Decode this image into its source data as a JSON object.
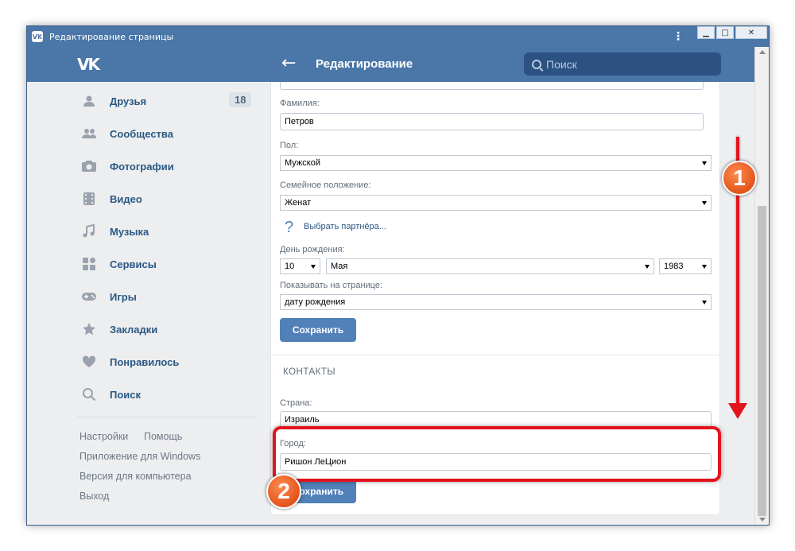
{
  "window": {
    "title": "Редактирование страницы",
    "app_badge": "VK",
    "close_glyph": "✕"
  },
  "header": {
    "logo": "VK",
    "title": "Редактирование",
    "search_placeholder": "Поиск"
  },
  "sidebar": {
    "items": [
      {
        "label": "Друзья",
        "icon": "person-icon",
        "badge": "18"
      },
      {
        "label": "Сообщества",
        "icon": "people-icon"
      },
      {
        "label": "Фотографии",
        "icon": "camera-icon"
      },
      {
        "label": "Видео",
        "icon": "film-icon"
      },
      {
        "label": "Музыка",
        "icon": "music-note-icon"
      },
      {
        "label": "Сервисы",
        "icon": "grid-icon"
      },
      {
        "label": "Игры",
        "icon": "gamepad-icon"
      },
      {
        "label": "Закладки",
        "icon": "star-icon"
      },
      {
        "label": "Понравилось",
        "icon": "heart-icon"
      },
      {
        "label": "Поиск",
        "icon": "search-icon"
      }
    ],
    "footer": {
      "settings": "Настройки",
      "help": "Помощь",
      "windows_app": "Приложение для Windows",
      "desktop_version": "Версия для компьютера",
      "logout": "Выход"
    }
  },
  "form": {
    "surname_label": "Фамилия:",
    "surname_value": "Петров",
    "gender_label": "Пол:",
    "gender_value": "Мужской",
    "marital_label": "Семейное положение:",
    "marital_value": "Женат",
    "partner_icon": "?",
    "partner_link": "Выбрать партнёра...",
    "birthday_label": "День рождения:",
    "birth_day": "10",
    "birth_month": "Мая",
    "birth_year": "1983",
    "show_label": "Показывать на странице:",
    "show_value": "дату рождения",
    "save_label": "Сохранить"
  },
  "contacts": {
    "section_title": "КОНТАКТЫ",
    "country_label": "Страна:",
    "country_value": "Израиль",
    "city_label": "Город:",
    "city_value": "Ришон ЛеЦион",
    "save_label": "Сохранить"
  },
  "annotations": {
    "marker1": "1",
    "marker2": "2",
    "color": "#e3141e"
  },
  "colors": {
    "brand": "#4a76a8",
    "button": "#5181b8",
    "link": "#2a5885"
  }
}
